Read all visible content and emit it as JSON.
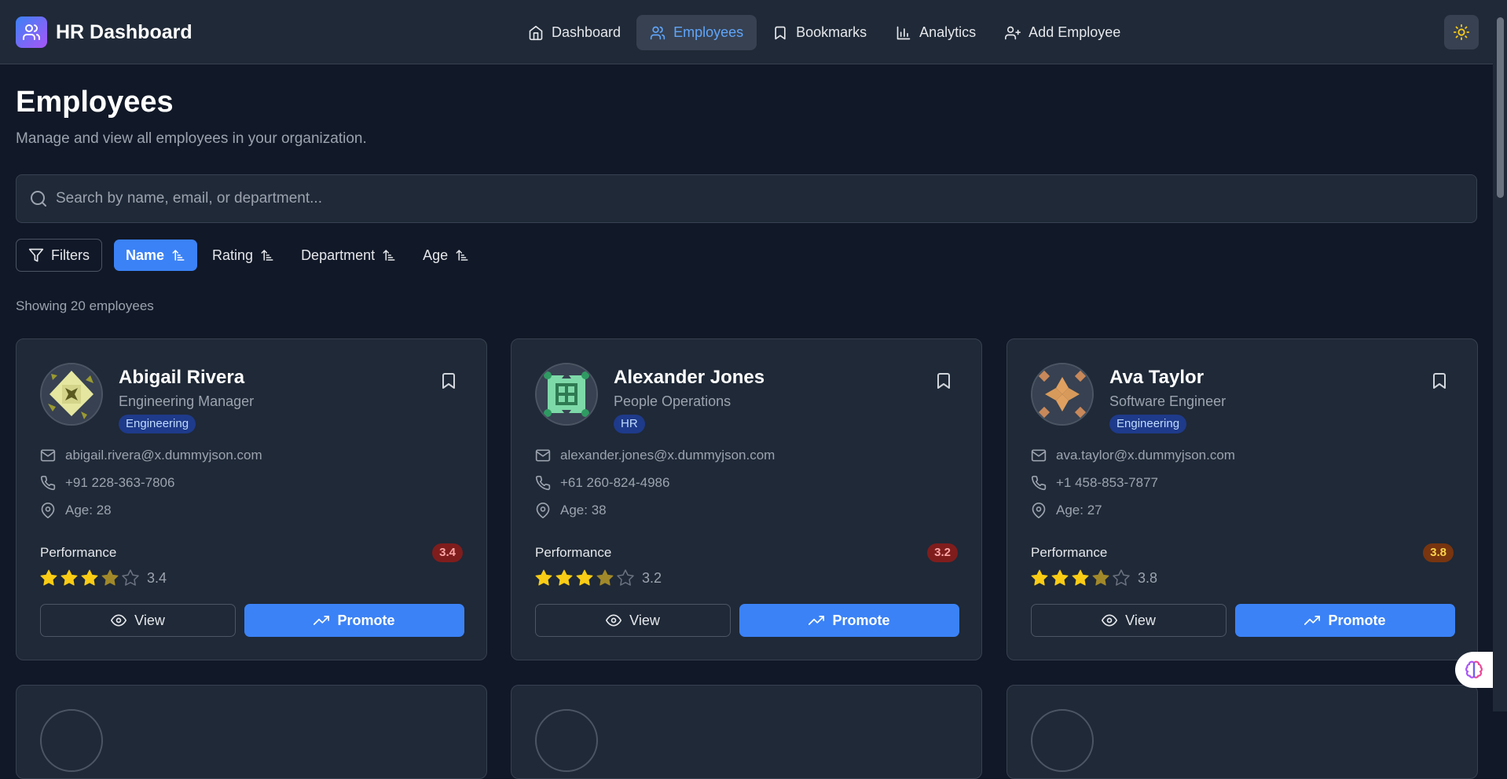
{
  "app": {
    "title": "HR Dashboard"
  },
  "nav": {
    "items": [
      {
        "label": "Dashboard",
        "icon": "home-icon"
      },
      {
        "label": "Employees",
        "icon": "users-icon",
        "active": true
      },
      {
        "label": "Bookmarks",
        "icon": "bookmark-icon"
      },
      {
        "label": "Analytics",
        "icon": "bar-chart-icon"
      },
      {
        "label": "Add Employee",
        "icon": "user-plus-icon"
      }
    ],
    "theme_icon": "sun-icon"
  },
  "page": {
    "title": "Employees",
    "subtitle": "Manage and view all employees in your organization."
  },
  "search": {
    "placeholder": "Search by name, email, or department..."
  },
  "toolbar": {
    "filters_label": "Filters",
    "sort_options": [
      {
        "label": "Name",
        "active": true
      },
      {
        "label": "Rating"
      },
      {
        "label": "Department"
      },
      {
        "label": "Age"
      }
    ]
  },
  "results": {
    "showing": "Showing 20 employees"
  },
  "employees": [
    {
      "name": "Abigail Rivera",
      "role": "Engineering Manager",
      "department": "Engineering",
      "email": "abigail.rivera@x.dummyjson.com",
      "phone": "+91 228-363-7806",
      "age": "Age: 28",
      "performance_label": "Performance",
      "rating": "3.4",
      "rating_value": 3.4,
      "badge_color": "#7f1d1d",
      "view_label": "View",
      "promote_label": "Promote"
    },
    {
      "name": "Alexander Jones",
      "role": "People Operations",
      "department": "HR",
      "email": "alexander.jones@x.dummyjson.com",
      "phone": "+61 260-824-4986",
      "age": "Age: 38",
      "performance_label": "Performance",
      "rating": "3.2",
      "rating_value": 3.2,
      "badge_color": "#7f1d1d",
      "view_label": "View",
      "promote_label": "Promote"
    },
    {
      "name": "Ava Taylor",
      "role": "Software Engineer",
      "department": "Engineering",
      "email": "ava.taylor@x.dummyjson.com",
      "phone": "+1 458-853-7877",
      "age": "Age: 27",
      "performance_label": "Performance",
      "rating": "3.8",
      "rating_value": 3.8,
      "badge_color": "#78350f",
      "view_label": "View",
      "promote_label": "Promote"
    }
  ],
  "colors": {
    "accent": "#3b82f6",
    "background": "#111827",
    "card": "#1f2937",
    "star": "#facc15"
  }
}
